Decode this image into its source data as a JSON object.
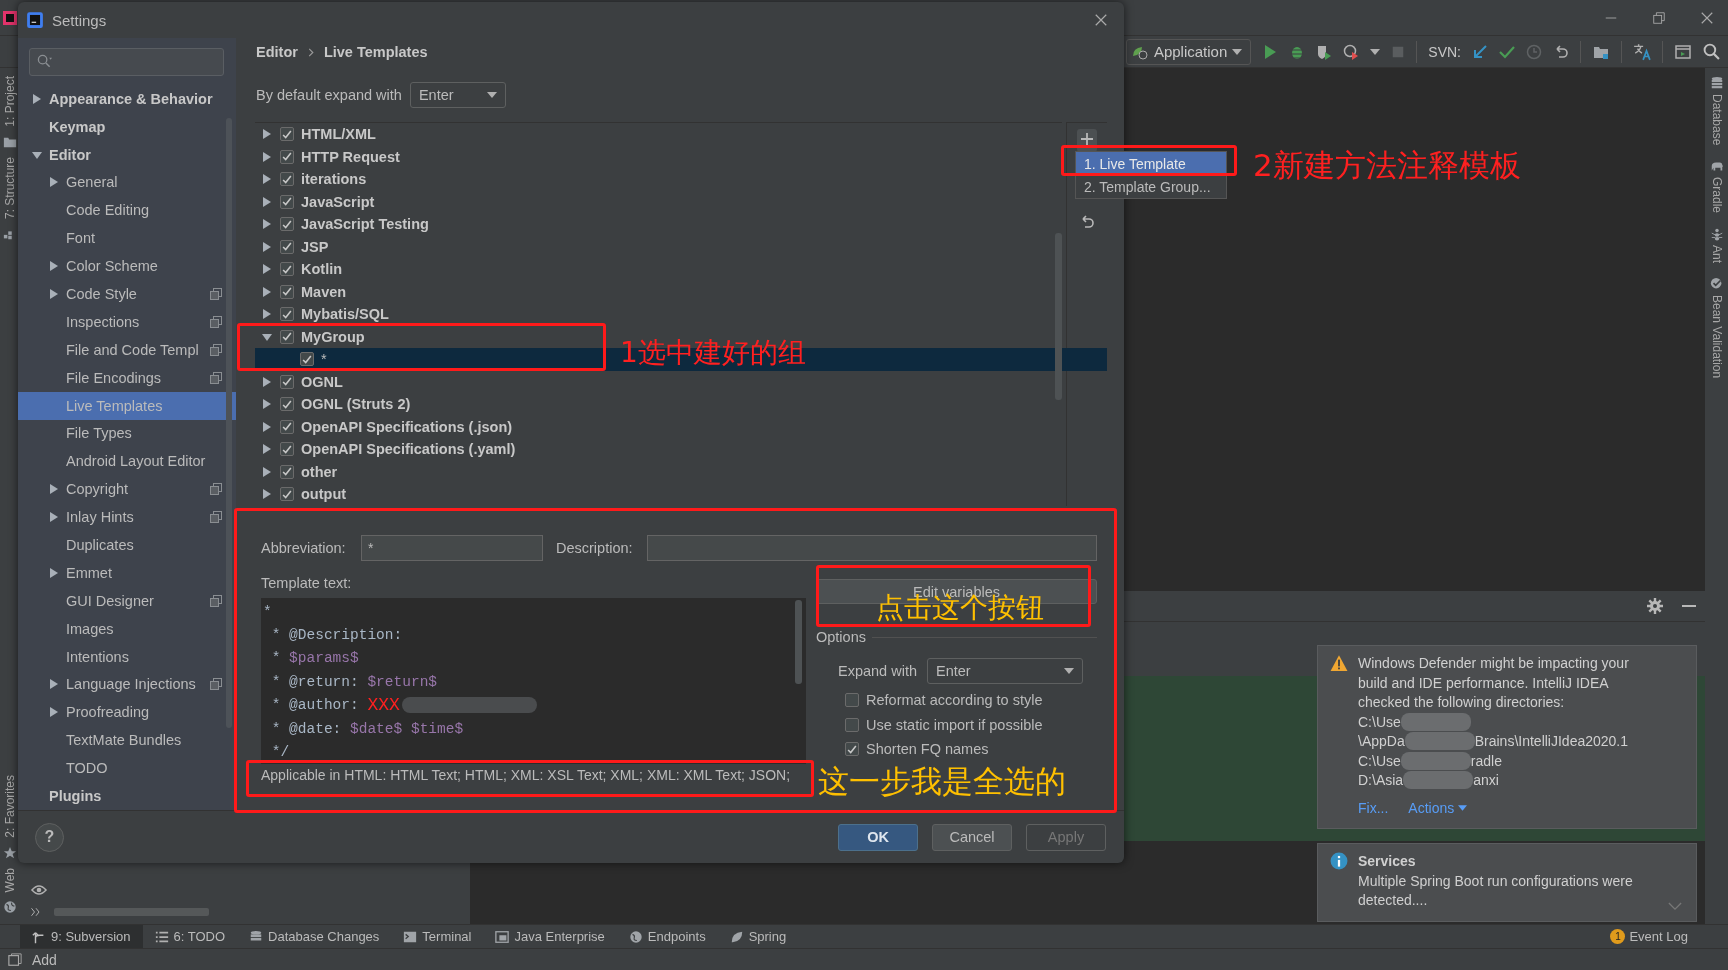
{
  "ide": {
    "toolbar": {
      "run_configuration": "Application",
      "vcs_label": "SVN:"
    },
    "left_tool_tabs_top": [
      "1: Project",
      "7: Structure"
    ],
    "left_tool_tabs_bottom": [
      "2: Favorites",
      "Web"
    ],
    "right_tool_tabs": [
      "Database",
      "Gradle",
      "Ant",
      "Bean Validation"
    ],
    "notifications": [
      {
        "kind": "warning",
        "text": "Windows Defender might be impacting your build and IDE performance. IntelliJ IDEA checked the following directories:",
        "paths": [
          {
            "start": "C:\\Use"
          },
          {
            "start": "\\AppDa",
            "end": "Brains\\IntelliJIdea2020.1"
          },
          {
            "start": "C:\\Use",
            "end": "radle"
          },
          {
            "start": "D:\\Asia",
            "end": "anxi"
          }
        ],
        "actions": [
          {
            "label": "Fix...",
            "menu": false
          },
          {
            "label": "Actions",
            "menu": true
          }
        ]
      },
      {
        "kind": "info",
        "title": "Services",
        "text": "Multiple Spring Boot run configurations were detected...."
      }
    ],
    "bottom_tool_tabs": [
      {
        "label": "9: Subversion",
        "selected": true
      },
      {
        "label": "6: TODO",
        "selected": false
      },
      {
        "label": "Database Changes",
        "selected": false
      },
      {
        "label": "Terminal",
        "selected": false
      },
      {
        "label": "Java Enterprise",
        "selected": false
      },
      {
        "label": "Endpoints",
        "selected": false
      },
      {
        "label": "Spring",
        "selected": false
      }
    ],
    "event_log": {
      "label": "Event Log",
      "badge": "1"
    },
    "status_bar": {
      "message": "Add"
    }
  },
  "settings": {
    "title": "Settings",
    "sidebar": [
      {
        "label": "Appearance & Behavior",
        "expanded": false,
        "selected": false,
        "scoped": false
      },
      {
        "label": "Keymap",
        "selected": false,
        "scoped": false
      },
      {
        "label": "Editor",
        "expanded": true,
        "selected": false,
        "scoped": false,
        "children": [
          {
            "label": "General",
            "expanded": false,
            "selected": false,
            "scoped": false
          },
          {
            "label": "Code Editing",
            "selected": false,
            "scoped": false
          },
          {
            "label": "Font",
            "selected": false,
            "scoped": false
          },
          {
            "label": "Color Scheme",
            "expanded": false,
            "selected": false,
            "scoped": false
          },
          {
            "label": "Code Style",
            "expanded": false,
            "selected": false,
            "scoped": true
          },
          {
            "label": "Inspections",
            "selected": false,
            "scoped": true
          },
          {
            "label": "File and Code Templ",
            "selected": false,
            "scoped": true
          },
          {
            "label": "File Encodings",
            "selected": false,
            "scoped": true
          },
          {
            "label": "Live Templates",
            "selected": true,
            "scoped": false
          },
          {
            "label": "File Types",
            "selected": false,
            "scoped": false
          },
          {
            "label": "Android Layout Editor",
            "selected": false,
            "scoped": false
          },
          {
            "label": "Copyright",
            "expanded": false,
            "selected": false,
            "scoped": true
          },
          {
            "label": "Inlay Hints",
            "expanded": false,
            "selected": false,
            "scoped": true
          },
          {
            "label": "Duplicates",
            "selected": false,
            "scoped": false
          },
          {
            "label": "Emmet",
            "expanded": false,
            "selected": false,
            "scoped": false
          },
          {
            "label": "GUI Designer",
            "selected": false,
            "scoped": true
          },
          {
            "label": "Images",
            "selected": false,
            "scoped": false
          },
          {
            "label": "Intentions",
            "selected": false,
            "scoped": false
          },
          {
            "label": "Language Injections",
            "expanded": false,
            "selected": false,
            "scoped": true
          },
          {
            "label": "Proofreading",
            "expanded": false,
            "selected": false,
            "scoped": false
          },
          {
            "label": "TextMate Bundles",
            "selected": false,
            "scoped": false
          },
          {
            "label": "TODO",
            "selected": false,
            "scoped": false
          }
        ]
      },
      {
        "label": "Plugins",
        "selected": false,
        "scoped": false
      }
    ],
    "breadcrumb": [
      "Editor",
      "Live Templates"
    ],
    "default_expand": {
      "label": "By default expand with",
      "value": "Enter"
    },
    "template_groups": [
      {
        "label": "HTML/XML",
        "checked": true,
        "expanded": false,
        "selected": false
      },
      {
        "label": "HTTP Request",
        "checked": true,
        "expanded": false,
        "selected": false
      },
      {
        "label": "iterations",
        "checked": true,
        "expanded": false,
        "selected": false
      },
      {
        "label": "JavaScript",
        "checked": true,
        "expanded": false,
        "selected": false
      },
      {
        "label": "JavaScript Testing",
        "checked": true,
        "expanded": false,
        "selected": false
      },
      {
        "label": "JSP",
        "checked": true,
        "expanded": false,
        "selected": false
      },
      {
        "label": "Kotlin",
        "checked": true,
        "expanded": false,
        "selected": false
      },
      {
        "label": "Maven",
        "checked": true,
        "expanded": false,
        "selected": false
      },
      {
        "label": "Mybatis/SQL",
        "checked": true,
        "expanded": false,
        "selected": false
      },
      {
        "label": "MyGroup",
        "checked": true,
        "expanded": true,
        "selected": false,
        "children": [
          {
            "label": "*",
            "checked": true,
            "selected": true
          }
        ]
      },
      {
        "label": "OGNL",
        "checked": true,
        "expanded": false,
        "selected": false
      },
      {
        "label": "OGNL (Struts 2)",
        "checked": true,
        "expanded": false,
        "selected": false
      },
      {
        "label": "OpenAPI Specifications (.json)",
        "checked": true,
        "expanded": false,
        "selected": false
      },
      {
        "label": "OpenAPI Specifications (.yaml)",
        "checked": true,
        "expanded": false,
        "selected": false
      },
      {
        "label": "other",
        "checked": true,
        "expanded": false,
        "selected": false
      },
      {
        "label": "output",
        "checked": true,
        "expanded": false,
        "selected": false
      }
    ],
    "add_menu": [
      {
        "label": "1. Live Template",
        "selected": true
      },
      {
        "label": "2. Template Group...",
        "selected": false
      }
    ],
    "editor": {
      "abbreviation": {
        "label": "Abbreviation:",
        "value": "*"
      },
      "description": {
        "label": "Description:"
      },
      "template_label": "Template text:",
      "template_lines": [
        {
          "segments": [
            {
              "text": "*",
              "kind": "text"
            }
          ],
          "redacted": false
        },
        {
          "segments": [
            {
              "text": " * @Description:",
              "kind": "text"
            }
          ],
          "redacted": false
        },
        {
          "segments": [
            {
              "text": " * ",
              "kind": "text"
            },
            {
              "text": "$params$",
              "kind": "variable"
            }
          ],
          "redacted": false
        },
        {
          "segments": [
            {
              "text": " * @return: ",
              "kind": "text"
            },
            {
              "text": "$return$",
              "kind": "variable"
            }
          ],
          "redacted": false
        },
        {
          "segments": [
            {
              "text": " * @author: ",
              "kind": "text"
            },
            {
              "text": "XXX",
              "kind": "mark"
            }
          ],
          "redacted": true
        },
        {
          "segments": [
            {
              "text": " * @date: ",
              "kind": "text"
            },
            {
              "text": "$date$ $time$",
              "kind": "variable"
            }
          ],
          "redacted": false
        },
        {
          "segments": [
            {
              "text": " */",
              "kind": "text"
            }
          ],
          "redacted": false
        }
      ],
      "applicable": "Applicable in HTML: HTML Text; HTML; XML: XSL Text; XML; XML: XML Text; JSON;",
      "edit_variables": "Edit variables",
      "options": {
        "title": "Options",
        "expand_label": "Expand with",
        "expand_value": "Enter",
        "checkboxes": [
          {
            "label": "Reformat according to style",
            "checked": false
          },
          {
            "label": "Use static import if possible",
            "checked": false
          },
          {
            "label": "Shorten FQ names",
            "checked": true
          }
        ]
      }
    },
    "help": "?",
    "buttons": [
      {
        "label": "OK",
        "kind": "primary"
      },
      {
        "label": "Cancel",
        "kind": "normal"
      },
      {
        "label": "Apply",
        "kind": "disabled"
      }
    ]
  },
  "annotations": [
    {
      "text": "1选中建好的组",
      "color": "#ff2020"
    },
    {
      "text": "2新建方法注释模板",
      "color": "#ff2020"
    },
    {
      "text": "点击这个按钮",
      "color": "#ffc000"
    },
    {
      "text": "这一步我是全选的",
      "color": "#ffc000"
    }
  ]
}
